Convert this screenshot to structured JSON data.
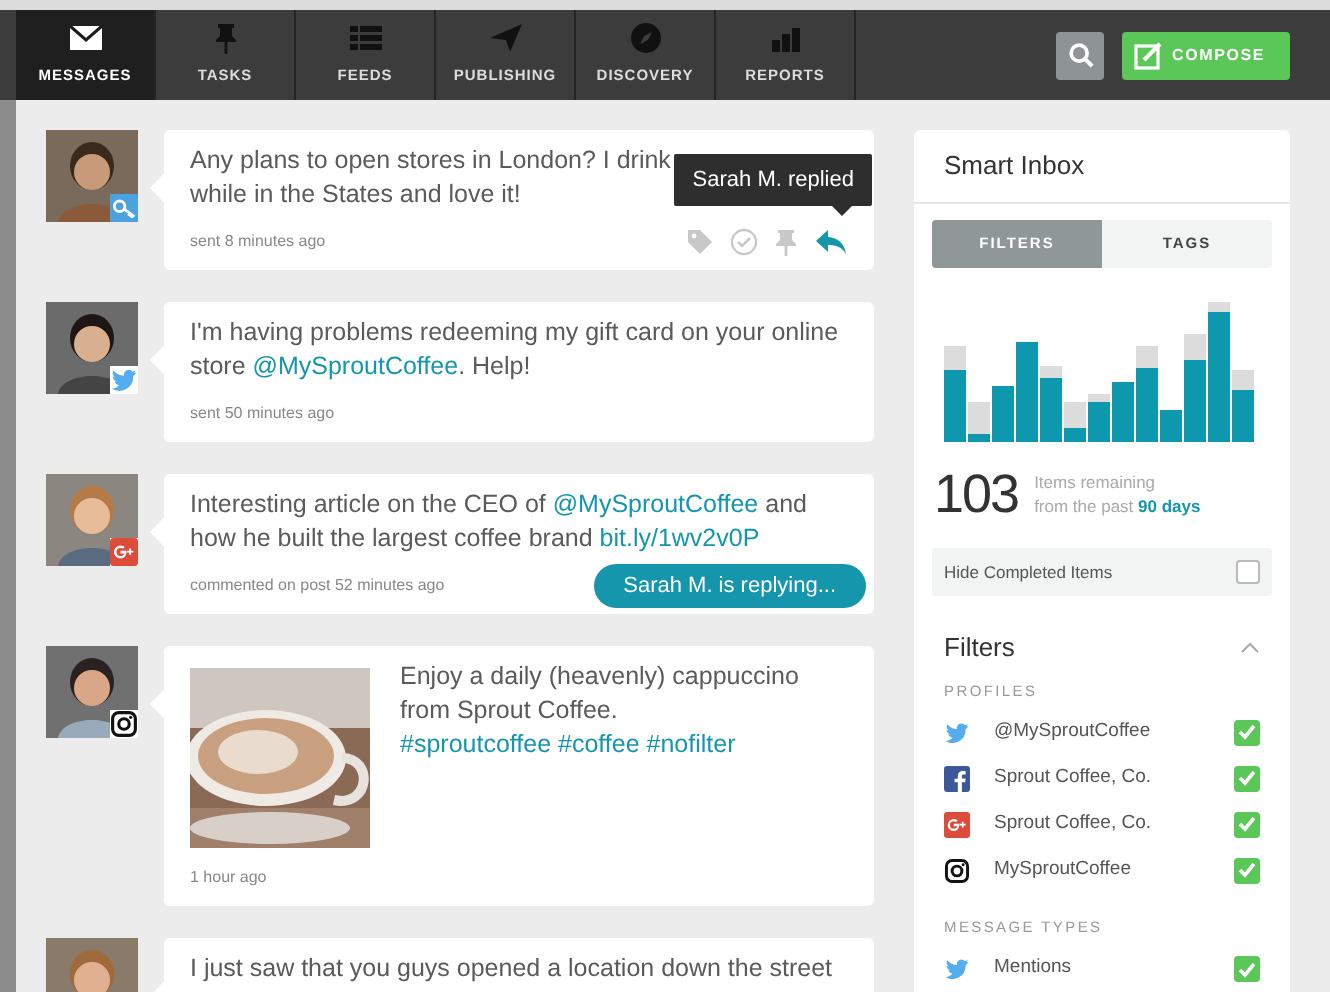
{
  "nav": {
    "tabs": [
      {
        "label": "MESSAGES",
        "selected": true
      },
      {
        "label": "TASKS",
        "selected": false
      },
      {
        "label": "FEEDS",
        "selected": false
      },
      {
        "label": "PUBLISHING",
        "selected": false
      },
      {
        "label": "DISCOVERY",
        "selected": false
      },
      {
        "label": "REPORTS",
        "selected": false
      }
    ],
    "compose": "COMPOSE"
  },
  "messages": [
    {
      "kind": "key",
      "text": [
        {
          "kind": "line",
          "t": "Any plans to open stores in London? I drink"
        },
        {
          "kind": "line",
          "t": "while in the States and love it!"
        }
      ],
      "time": "sent 8 minutes ago",
      "replied": true,
      "tooltip": "Sarah M. replied"
    },
    {
      "kind": "twitter",
      "text": [
        {
          "kind": "plain",
          "t": "I'm having problems redeeming my gift card on your online store "
        },
        {
          "kind": "link",
          "t": "@MySproutCoffee"
        },
        {
          "kind": "plain",
          "t": ". Help!"
        }
      ],
      "time": "sent 50 minutes ago"
    },
    {
      "kind": "google_plus",
      "text": [
        {
          "kind": "plain",
          "t": "Interesting article on the CEO of "
        },
        {
          "kind": "link",
          "t": "@MySproutCoffee"
        },
        {
          "kind": "plain",
          "t": " and how he built the largest coffee brand "
        },
        {
          "kind": "link",
          "t": "bit.ly/1wv2v0P"
        }
      ],
      "time": "commented on post 52 minutes ago",
      "status": "Sarah M. is replying..."
    },
    {
      "kind": "instagram_picture",
      "text": [
        {
          "kind": "plain",
          "t": "Enjoy a daily (heavenly) cappuccino from Sprout Coffee. "
        },
        {
          "kind": "link",
          "t": "#sproutcoffee"
        },
        {
          "kind": "link",
          "t": " #coffee"
        },
        {
          "kind": "link",
          "t": " #nofilter"
        }
      ],
      "time": "1 hour ago"
    },
    {
      "kind": "plain",
      "text": [
        {
          "kind": "plain",
          "t": "I just saw that you guys opened a location down the street"
        }
      ]
    }
  ],
  "inbox": {
    "title": "Smart Inbox",
    "tabs": [
      {
        "label": "FILTERS",
        "selected": true
      },
      {
        "label": "TAGS",
        "selected": false
      }
    ],
    "count": "103",
    "remaining": "Items remaining",
    "past": "from the past ",
    "days": "90 days",
    "hide_completed": {
      "label": "Hide Completed Items",
      "checked": false
    },
    "filters": {
      "title": "Filters",
      "expanded": true,
      "groups": [
        {
          "title": "PROFILES",
          "items": [
            {
              "kind": "twitter",
              "label": "@MySproutCoffee",
              "checked": true
            },
            {
              "kind": "facebook",
              "label": "Sprout Coffee, Co.",
              "checked": true
            },
            {
              "kind": "google_plus",
              "label": "Sprout Coffee, Co.",
              "checked": true
            },
            {
              "kind": "instagram",
              "label": "MySproutCoffee",
              "checked": true
            }
          ]
        },
        {
          "title": "MESSAGE TYPES",
          "items": [
            {
              "kind": "twitter",
              "label": "Mentions",
              "checked": true
            }
          ]
        }
      ]
    }
  }
}
